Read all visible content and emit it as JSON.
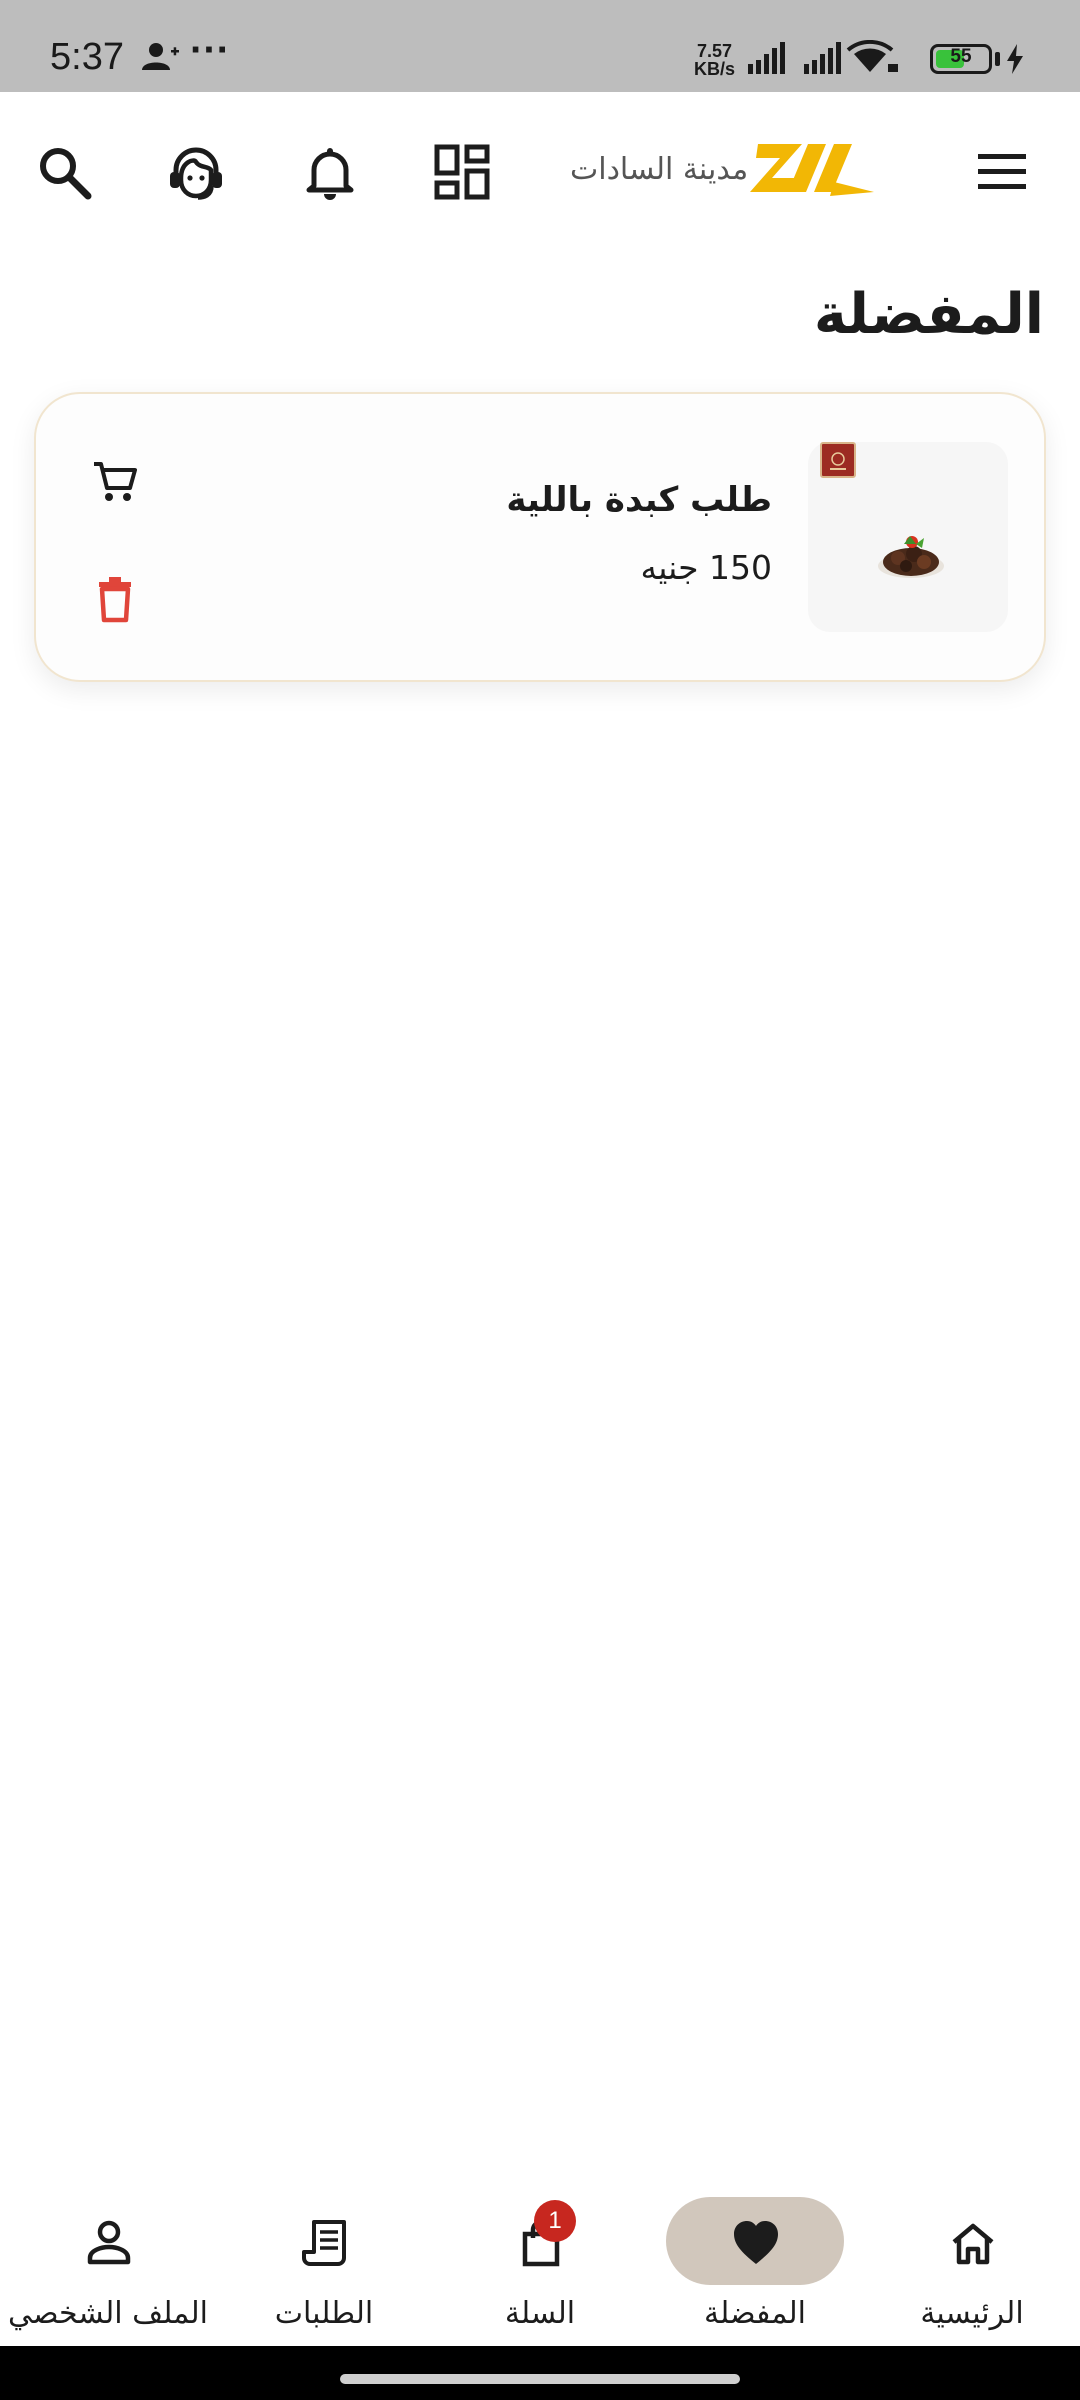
{
  "status_bar": {
    "time": "5:37",
    "more": "···",
    "net_speed_value": "7.57",
    "net_speed_unit": "KB/s",
    "battery_level": "55",
    "battery_fraction": 0.55
  },
  "header": {
    "logo_text": "مدينة السادات",
    "icons": [
      "search-icon",
      "support-agent-icon",
      "bell-icon",
      "dashboard-grid-icon",
      "menu-icon"
    ]
  },
  "page": {
    "title": "المفضلة"
  },
  "favorites": [
    {
      "name": "طلب كبدة باللية",
      "price": "150 جنيه"
    }
  ],
  "bottom_nav": {
    "items": [
      {
        "label": "الرئيسية",
        "icon": "home-icon"
      },
      {
        "label": "المفضلة",
        "icon": "heart-icon",
        "active": true
      },
      {
        "label": "السلة",
        "icon": "shopping-bag-icon",
        "badge": "1"
      },
      {
        "label": "الطلبات",
        "icon": "receipt-icon"
      },
      {
        "label": "الملف الشخصي",
        "icon": "person-icon"
      }
    ]
  },
  "colors": {
    "accent_pill": "#d1c7bc",
    "badge": "#c7271f",
    "delete": "#e0453a",
    "logo_yellow": "#f2b705",
    "card_border": "#f1e5cf"
  }
}
